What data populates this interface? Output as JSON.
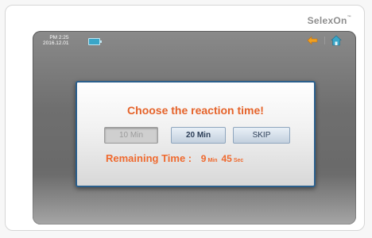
{
  "brand": {
    "name": "SelexOn",
    "mark": "™"
  },
  "status_bar": {
    "time": "PM 2:25",
    "date": "2016.12.01",
    "icons": [
      "battery-icon",
      "back-arrow-icon",
      "home-icon"
    ]
  },
  "dialog": {
    "title": "Choose the reaction time!",
    "buttons": {
      "ten_min": "10 Min",
      "twenty_min": "20 Min",
      "skip": "SKIP"
    },
    "remaining": {
      "label": "Remaining Time :",
      "minutes": "9",
      "minutes_unit": "Min",
      "seconds": "45",
      "seconds_unit": "Sec"
    }
  },
  "colors": {
    "accent_orange": "#e5632a",
    "dialog_border": "#2b5f8c",
    "home_icon": "#3aa6c8"
  }
}
